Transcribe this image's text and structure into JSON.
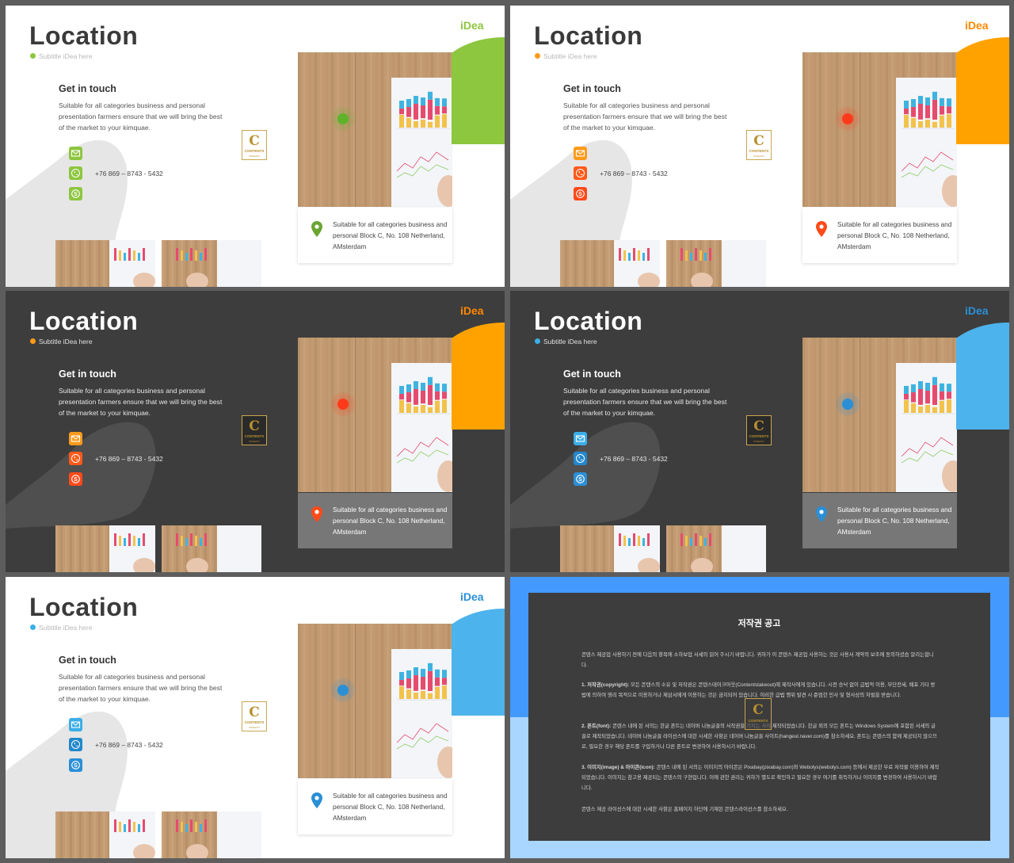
{
  "slides": [
    {
      "theme": "light",
      "accent": "#8dc63f",
      "logo": {
        "i": "i",
        "rest": "Dea",
        "i_color": "#8dc63f",
        "rest_color": "#8dc63f"
      },
      "title": "Location",
      "subtitle": "Subtitle iDea here",
      "get_in_touch": "Get in touch",
      "description": "Suitable for all categories business and personal presentation farmers ensure that we will bring the best of the market to your kimquae.",
      "phone": "+76 869 – 8743 - 5432",
      "icon_color": "#8dc63f",
      "pin_color": "#6aa533",
      "ring_color": "#5fb32a",
      "badge": {
        "letter": "C",
        "line1": "CONTENTS",
        "line2": "TAKEOUT"
      },
      "address": "Suitable for all categories business and personal Block C, No. 108 Netherland, AMsterdam"
    },
    {
      "theme": "light",
      "accent": "#ffa200",
      "logo": {
        "i": "i",
        "rest": "Dea",
        "i_color": "#ff8800",
        "rest_color": "#ff8800"
      },
      "title": "Location",
      "subtitle": "Subtitle iDea here",
      "get_in_touch": "Get in touch",
      "description": "Suitable for all categories business and personal presentation farmers ensure that we will bring the best of the market to your kimquae.",
      "phone": "+76 869 – 8743 - 5432",
      "icon_color": "#ff9a1a",
      "icon_color_alt": "#ff5a1a",
      "pin_color": "#ff4a1a",
      "ring_color": "#ff3a1a",
      "badge": {
        "letter": "C",
        "line1": "CONTENTS",
        "line2": "TAKEOUT"
      },
      "address": "Suitable for all categories business and personal Block C, No. 108 Netherland, AMsterdam"
    },
    {
      "theme": "dark",
      "accent": "#ffa200",
      "logo": {
        "i": "i",
        "rest": "Dea",
        "i_color": "#ff8800",
        "rest_color": "#ff8800"
      },
      "title": "Location",
      "subtitle": "Subtitle iDea here",
      "get_in_touch": "Get in touch",
      "description": "Suitable for all categories business and personal presentation farmers ensure that we will bring the best of the market to your kimquae.",
      "phone": "+76 869 – 8743 - 5432",
      "icon_color": "#ff9a1a",
      "icon_color_alt": "#ff5a1a",
      "pin_color": "#ff4a1a",
      "ring_color": "#ff3a1a",
      "badge": {
        "letter": "C",
        "line1": "CONTENTS",
        "line2": "TAKEOUT"
      },
      "address": "Suitable for all categories business and personal Block C, No. 108 Netherland, AMsterdam"
    },
    {
      "theme": "dark",
      "accent": "#4db3ec",
      "logo": {
        "i": "i",
        "rest": "Dea",
        "i_color": "#2b8fd6",
        "rest_color": "#2b8fd6"
      },
      "title": "Location",
      "subtitle": "Subtitle iDea here",
      "get_in_touch": "Get in touch",
      "description": "Suitable for all categories business and personal presentation farmers ensure that we will bring the best of the market to your kimquae.",
      "phone": "+76 869 – 8743 - 5432",
      "icon_color": "#3aaee8",
      "icon_color_alt": "#2288cc",
      "pin_color": "#2b8fd6",
      "ring_color": "#2b8fd6",
      "badge": {
        "letter": "C",
        "line1": "CONTENTS",
        "line2": "TAKEOUT"
      },
      "address": "Suitable for all categories business and personal Block C, No. 108 Netherland, AMsterdam"
    },
    {
      "theme": "light",
      "accent": "#4db3ec",
      "logo": {
        "i": "i",
        "rest": "Dea",
        "i_color": "#2b8fd6",
        "rest_color": "#2b8fd6"
      },
      "title": "Location",
      "subtitle": "Subtitle iDea here",
      "get_in_touch": "Get in touch",
      "description": "Suitable for all categories business and personal presentation farmers ensure that we will bring the best of the market to your kimquae.",
      "phone": "+76 869 – 8743 - 5432",
      "icon_color": "#3aaee8",
      "icon_color_alt": "#2288cc",
      "pin_color": "#2b8fd6",
      "ring_color": "#2b8fd6",
      "badge": {
        "letter": "C",
        "line1": "CONTENTS",
        "line2": "TAKEOUT"
      },
      "address": "Suitable for all categories business and personal Block C, No. 108 Netherland, AMsterdam"
    }
  ],
  "notice": {
    "title": "저작권 공고",
    "p1": "콘텐스 제공업 사용하기 전에 다음의 항목에 소하보업 서세의 읽어 주시기 바랍니다. 귀하가 이 콘텐스 제공업 사용하는 것은 사용서 계약의 보조에 동의하셨습 알리는합니다.",
    "p2_label": "1. 저작권(copyright):",
    "p2": " 모든 콘텐스의 소유 및 저작권은 콘텐스테이크아웃(Contentstakeout)에 제작사에게 있습니다. 시전 승낙 없이 급법적 이용, 무단전세, 배포 기타 방법에 의하여 영리 목적으로 이용하거나 제삼서에게 이용하는 것은 금지되어 있습니다. 이러한 급법 행위 발견 시 준엄한 민사 및 형사상의 처벌을 받습니다.",
    "p3_label": "2. 폰트(font):",
    "p3": " 콘텐스 내에 된 서의는 한글 폰트는 네이버 나눔글꼴의 서작권을 가지는 사이 제작되었습니다. 한글 외의 모든 폰트는 Windows System에 포함된 서세의 글꼴로 제작되었습니다. 네이버 나눔글꼴 라이선스에 대한 시세한 사항은 네이버 나눔글꼴 사이트(hangeul.naver.com)를 참소하세요. 폰트는 콘텐스의 함께 제공되지 않으므로, 필요한 경우 해당 폰트를 구입하거나 다른 폰트로 변경하여 사용하시기 바랍니다.",
    "p4_label": "3. 이미지(image) & 아이콘(icon):",
    "p4": " 콘텐스 내에 된 서의는 이미지의 아이콘은 Pixabay(pixabay.com)와 Webolys(webolys.com) 등에서 제공한 무료 저작물 이용하여 제작되었습니다. 이미지는 참고용 제공되는 콘텐스의 구현입니다. 이에 관한 권리는 귀하가 별도로 확인하고 필요한 경우 여기를 취득하거나 이미지를 변경하여 사용하시기 바랍니다.",
    "p5": "콘텐스 제공 라이선스에 대한 시세한 사항은 홈페이지 하단에 기재된 콘텐스라이선스를 참소하세요."
  }
}
